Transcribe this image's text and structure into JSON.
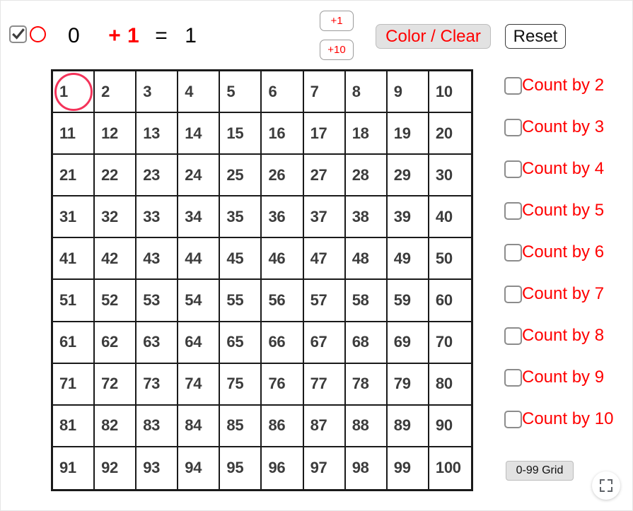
{
  "toolbar": {
    "mode_checkbox_checked": true,
    "mode_circle_color": "#ff0000",
    "equation": {
      "start": "0",
      "step": "+ 1",
      "equals": "=",
      "total": "1"
    },
    "step_buttons": [
      {
        "label": "+1",
        "name": "step-plus-1"
      },
      {
        "label": "+10",
        "name": "step-plus-10"
      }
    ],
    "color_clear_label": "Color / Clear",
    "reset_label": "Reset",
    "accent_red": "#ff0000",
    "color_clear_bg": "#e2e2e2"
  },
  "grid": {
    "rows": 10,
    "cols": 10,
    "start": 1,
    "end": 100,
    "highlighted": 1,
    "highlight_ring_color": "#f4335a",
    "numbers": [
      [
        1,
        2,
        3,
        4,
        5,
        6,
        7,
        8,
        9,
        10
      ],
      [
        11,
        12,
        13,
        14,
        15,
        16,
        17,
        18,
        19,
        20
      ],
      [
        21,
        22,
        23,
        24,
        25,
        26,
        27,
        28,
        29,
        30
      ],
      [
        31,
        32,
        33,
        34,
        35,
        36,
        37,
        38,
        39,
        40
      ],
      [
        41,
        42,
        43,
        44,
        45,
        46,
        47,
        48,
        49,
        50
      ],
      [
        51,
        52,
        53,
        54,
        55,
        56,
        57,
        58,
        59,
        60
      ],
      [
        61,
        62,
        63,
        64,
        65,
        66,
        67,
        68,
        69,
        70
      ],
      [
        71,
        72,
        73,
        74,
        75,
        76,
        77,
        78,
        79,
        80
      ],
      [
        81,
        82,
        83,
        84,
        85,
        86,
        87,
        88,
        89,
        90
      ],
      [
        91,
        92,
        93,
        94,
        95,
        96,
        97,
        98,
        99,
        100
      ]
    ]
  },
  "sidebar": {
    "count_options": [
      {
        "label": "Count by 2",
        "checked": false
      },
      {
        "label": "Count by 3",
        "checked": false
      },
      {
        "label": "Count by 4",
        "checked": false
      },
      {
        "label": "Count by 5",
        "checked": false
      },
      {
        "label": "Count by 6",
        "checked": false
      },
      {
        "label": "Count by 7",
        "checked": false
      },
      {
        "label": "Count by 8",
        "checked": false
      },
      {
        "label": "Count by 9",
        "checked": false
      },
      {
        "label": "Count by 10",
        "checked": false
      }
    ],
    "grid_toggle_label": "0-99 Grid",
    "label_color": "#ff0000"
  },
  "footer": {
    "fullscreen_icon": "fullscreen-expand-icon"
  }
}
